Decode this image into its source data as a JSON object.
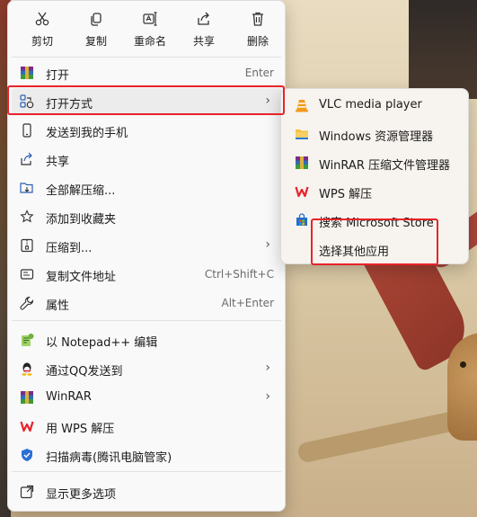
{
  "quick_actions": [
    {
      "label": "剪切",
      "icon": "cut-icon"
    },
    {
      "label": "复制",
      "icon": "copy-icon"
    },
    {
      "label": "重命名",
      "icon": "rename-icon"
    },
    {
      "label": "共享",
      "icon": "share-icon"
    },
    {
      "label": "删除",
      "icon": "delete-icon"
    }
  ],
  "menu": {
    "open": {
      "label": "打开",
      "shortcut": "Enter"
    },
    "open_with": {
      "label": "打开方式"
    },
    "send_phone": {
      "label": "发送到我的手机"
    },
    "share": {
      "label": "共享"
    },
    "extract_all": {
      "label": "全部解压缩..."
    },
    "favorites": {
      "label": "添加到收藏夹"
    },
    "compress_to": {
      "label": "压缩到..."
    },
    "copy_path": {
      "label": "复制文件地址",
      "shortcut": "Ctrl+Shift+C"
    },
    "properties": {
      "label": "属性",
      "shortcut": "Alt+Enter"
    },
    "notepad": {
      "label": "以 Notepad++ 编辑"
    },
    "send_qq": {
      "label": "通过QQ发送到"
    },
    "winrar": {
      "label": "WinRAR"
    },
    "wps_extract": {
      "label": "用 WPS 解压"
    },
    "scan_virus": {
      "label": "扫描病毒(腾讯电脑管家)"
    },
    "more_options": {
      "label": "显示更多选项"
    }
  },
  "open_with_submenu": [
    {
      "label": "VLC media player",
      "icon": "vlc-icon"
    },
    {
      "label": "Windows 资源管理器",
      "icon": "folder-icon"
    },
    {
      "label": "WinRAR 压缩文件管理器",
      "icon": "winrar-icon"
    },
    {
      "label": "WPS 解压",
      "icon": "wps-icon"
    },
    {
      "label": "搜索 Microsoft Store",
      "icon": "store-icon"
    },
    {
      "label": "选择其他应用",
      "icon": ""
    }
  ],
  "colors": {
    "highlight_box": "#e8232a",
    "menu_bg": "#f9f9f9",
    "hover": "#ececec"
  }
}
